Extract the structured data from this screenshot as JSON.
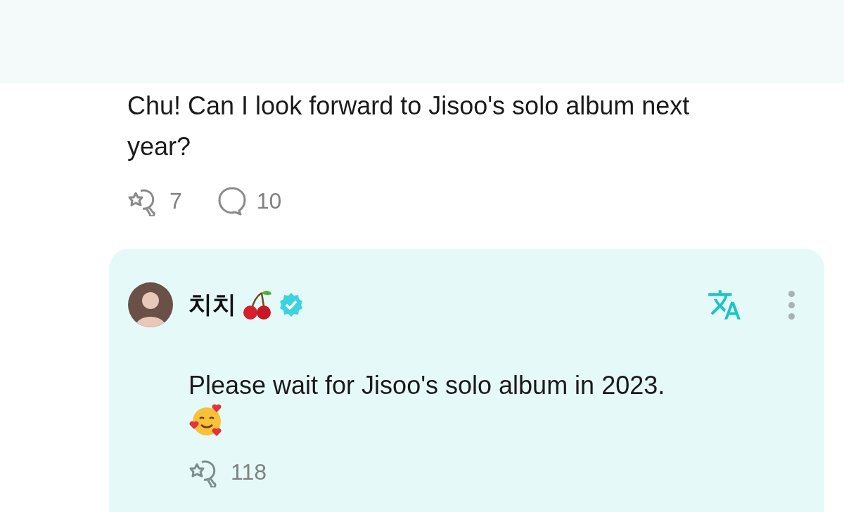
{
  "post": {
    "text": "Chu! Can I look forward to Jisoo's solo album next year?",
    "cheers": "7",
    "comments": "10"
  },
  "reply": {
    "author": "치치",
    "verified": true,
    "text": "Please wait for Jisoo's solo album in 2023.",
    "cheers": "118"
  }
}
